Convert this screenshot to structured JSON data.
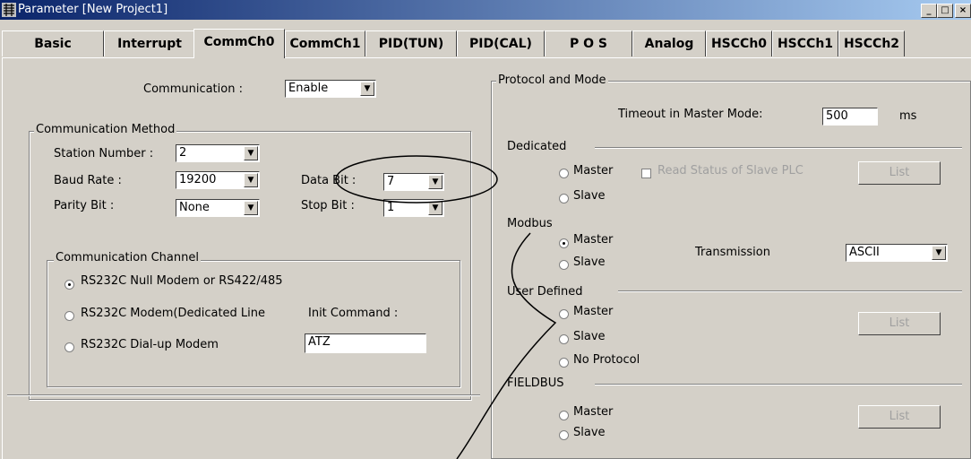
{
  "window": {
    "title": "Parameter [New Project1]",
    "controls": [
      "_",
      "□",
      "×"
    ]
  },
  "tabs": [
    {
      "label": "Basic"
    },
    {
      "label": "Interrupt"
    },
    {
      "label": "CommCh0"
    },
    {
      "label": "CommCh1"
    },
    {
      "label": "PID(TUN)"
    },
    {
      "label": "PID(CAL)"
    },
    {
      "label": "P O S"
    },
    {
      "label": "Analog"
    },
    {
      "label": "HSCCh0"
    },
    {
      "label": "HSCCh1"
    },
    {
      "label": "HSCCh2"
    }
  ],
  "communication": {
    "label": "Communication :",
    "value": "Enable"
  },
  "method": {
    "title": "Communication Method",
    "station_label": "Station Number :",
    "station_value": "2",
    "baud_label": "Baud Rate :",
    "baud_value": "19200",
    "databit_label": "Data Bit :",
    "databit_value": "7",
    "parity_label": "Parity Bit :",
    "parity_value": "None",
    "stopbit_label": "Stop Bit :",
    "stopbit_value": "1"
  },
  "channel": {
    "title": "Communication Channel",
    "opt1": "RS232C Null Modem or RS422/485",
    "opt2": "RS232C Modem(Dedicated Line",
    "opt3": "RS232C Dial-up Modem",
    "init_label": "Init Command :",
    "init_value": "ATZ"
  },
  "protocol": {
    "title": "Protocol and Mode",
    "timeout_label": "Timeout in Master Mode:",
    "timeout_value": "500",
    "timeout_unit": "ms",
    "dedicated": "Dedicated",
    "master": "Master",
    "slave": "Slave",
    "read_status": "Read Status of Slave PLC",
    "list": "List",
    "modbus": "Modbus",
    "transmission_label": "Transmission",
    "transmission_value": "ASCII",
    "user_defined": "User Defined",
    "no_protocol": "No Protocol",
    "fieldbus": "FIELDBUS"
  }
}
